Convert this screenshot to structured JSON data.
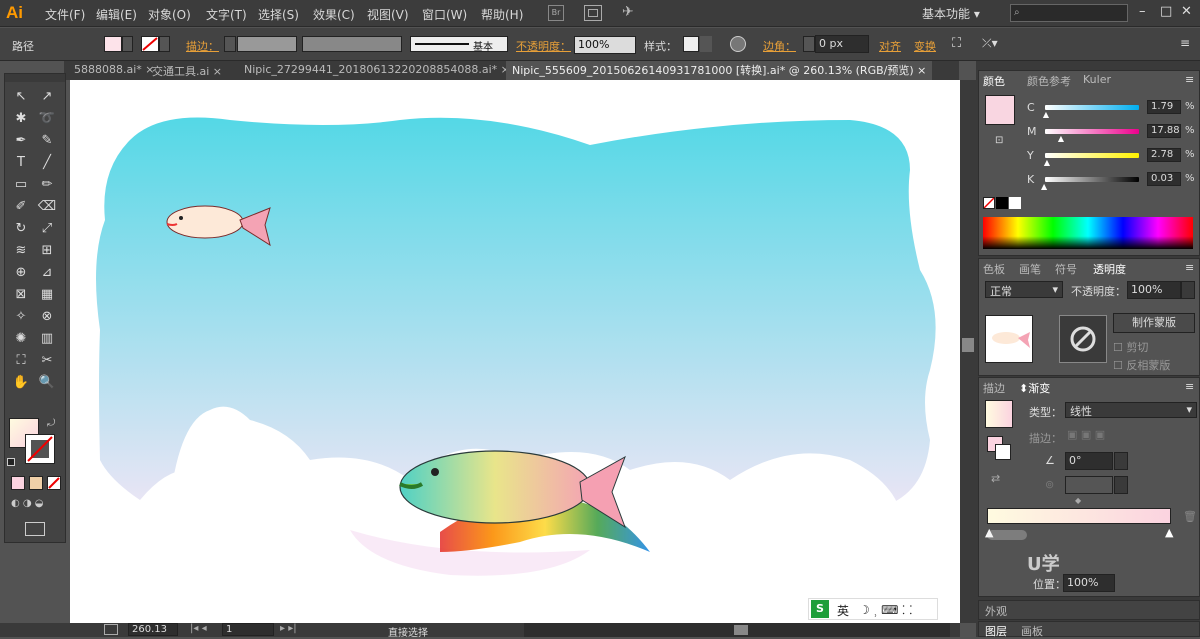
{
  "app": {
    "logo": "Ai"
  },
  "menu": [
    "文件(F)",
    "编辑(E)",
    "对象(O)",
    "文字(T)",
    "选择(S)",
    "效果(C)",
    "视图(V)",
    "窗口(W)",
    "帮助(H)"
  ],
  "workspace": {
    "label": "基本功能"
  },
  "window_controls": {
    "minimize": "–",
    "maximize": "□",
    "close": "✕"
  },
  "control": {
    "mode": "路径",
    "stroke_label": "描边：",
    "brush_label": "基本",
    "opacity_label": "不透明度：",
    "opacity_value": "100%",
    "style_label": "样式：",
    "corner_label": "边角：",
    "corner_value": "0 px",
    "align_label": "对齐",
    "transform_label": "变换"
  },
  "tabs": [
    "5888088.ai*",
    "交通工具.ai",
    "Nipic_27299441_20180613220208854088.ai*",
    "Nipic_555609_20150626140931781000 [转换].ai* @ 260.13% (RGB/预览)"
  ],
  "tab_close": "×",
  "status": {
    "zoom": "260.13",
    "artboard": "1",
    "tool": "直接选择"
  },
  "color_panel": {
    "tabs": [
      "颜色",
      "颜色参考",
      "Kuler"
    ],
    "channels": [
      {
        "name": "C",
        "value": "1.79",
        "unit": "%",
        "level": 0.02
      },
      {
        "name": "M",
        "value": "17.88",
        "unit": "%",
        "level": 0.18
      },
      {
        "name": "Y",
        "value": "2.78",
        "unit": "%",
        "level": 0.03
      },
      {
        "name": "K",
        "value": "0.03",
        "unit": "%",
        "level": 0.0
      }
    ],
    "swatch_color": "#f9d6e1"
  },
  "transparency_panel": {
    "tabs": [
      "色板",
      "画笔",
      "符号",
      "透明度"
    ],
    "blend_mode": "正常",
    "opacity_label": "不透明度：",
    "opacity_value": "100%",
    "make_mask": "制作蒙版",
    "clip": "剪切",
    "invert": "反相蒙版"
  },
  "gradient_panel": {
    "tabs": [
      "描边",
      "渐变"
    ],
    "type_label": "类型：",
    "type_value": "线性",
    "stroke_label": "描边：",
    "angle_value": "0°",
    "position_label": "位置：",
    "position_value": "100%",
    "start_color": "#fffbe0",
    "end_color": "#fbd3e0"
  },
  "appearance_tab": {
    "label": "外观"
  },
  "bottom_tabs": [
    "图层",
    "画板"
  ],
  "ime": {
    "lang": "英",
    "icon_label": "S"
  },
  "watermark": {
    "text": "U学"
  },
  "colors": {
    "sky_top": "#54d8e6",
    "sky_bottom": "#f4e6f6",
    "accent_orange": "#e8a038"
  }
}
